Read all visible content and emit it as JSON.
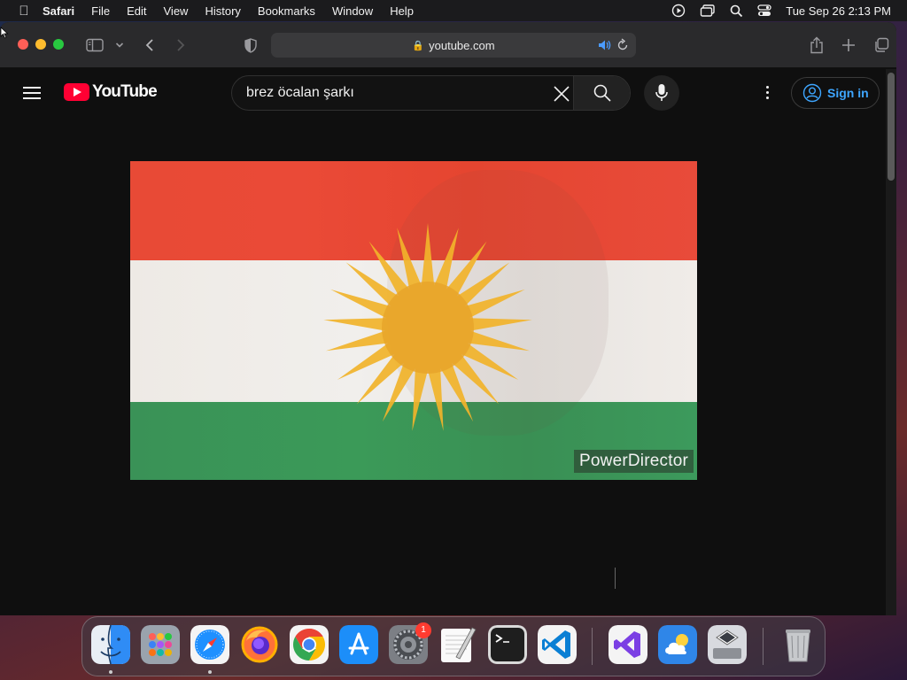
{
  "menubar": {
    "app_name": "Safari",
    "menus": [
      "File",
      "Edit",
      "View",
      "History",
      "Bookmarks",
      "Window",
      "Help"
    ],
    "clock": "Tue Sep 26  2:13 PM"
  },
  "browser": {
    "address": "youtube.com"
  },
  "youtube": {
    "logo_text": "YouTube",
    "search_value": "brez öcalan şarkı",
    "sign_in_label": "Sign in"
  },
  "video": {
    "watermark": "PowerDirector"
  },
  "dock": {
    "apps": [
      "Finder",
      "Launchpad",
      "Safari",
      "Firefox",
      "Chrome",
      "App Store",
      "System Settings",
      "TextEdit",
      "Terminal",
      "Visual Studio Code",
      "Visual Studio",
      "Weather",
      "Boot Camp Assistant",
      "Trash"
    ],
    "settings_badge": "1"
  }
}
